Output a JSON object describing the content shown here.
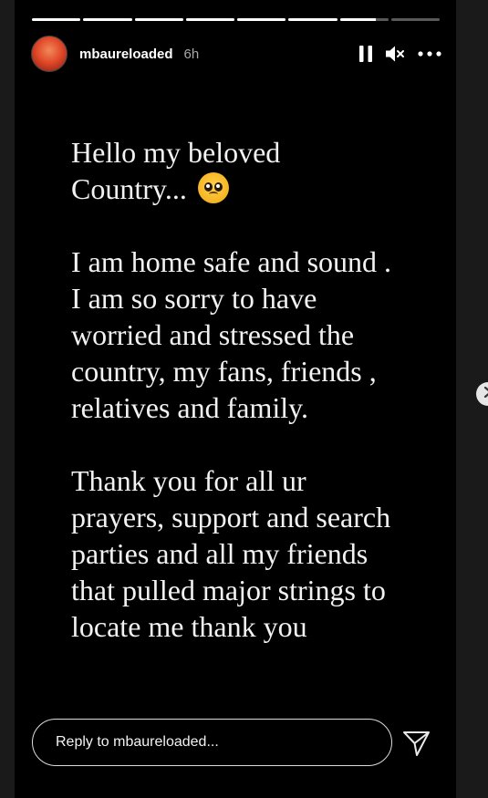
{
  "story": {
    "progress": [
      1,
      1,
      1,
      1,
      1,
      1,
      0.75,
      0
    ],
    "username": "mbaureloaded",
    "time": "6h",
    "paragraphs": [
      [
        "Hello my beloved",
        "Country..."
      ],
      [
        "I am home safe and sound .",
        "I am so sorry to have",
        "worried and stressed the",
        "country, my fans, friends ,",
        "relatives and family."
      ],
      [
        "Thank you for all ur",
        "prayers, support and search",
        "parties and all my friends",
        "that pulled major strings to",
        "locate me thank you"
      ]
    ],
    "emoji": "pleading-face-emoji"
  },
  "controls": {
    "pause_icon": "pause-icon",
    "mute_icon": "muted-speaker-icon",
    "more_icon": "more-options-icon"
  },
  "reply": {
    "placeholder": "Reply to mbaureloaded..."
  },
  "colors": {
    "background": "#000000",
    "page": "#1a1a1a",
    "text": "#f2f2f2",
    "muted": "#a8a8a8"
  }
}
